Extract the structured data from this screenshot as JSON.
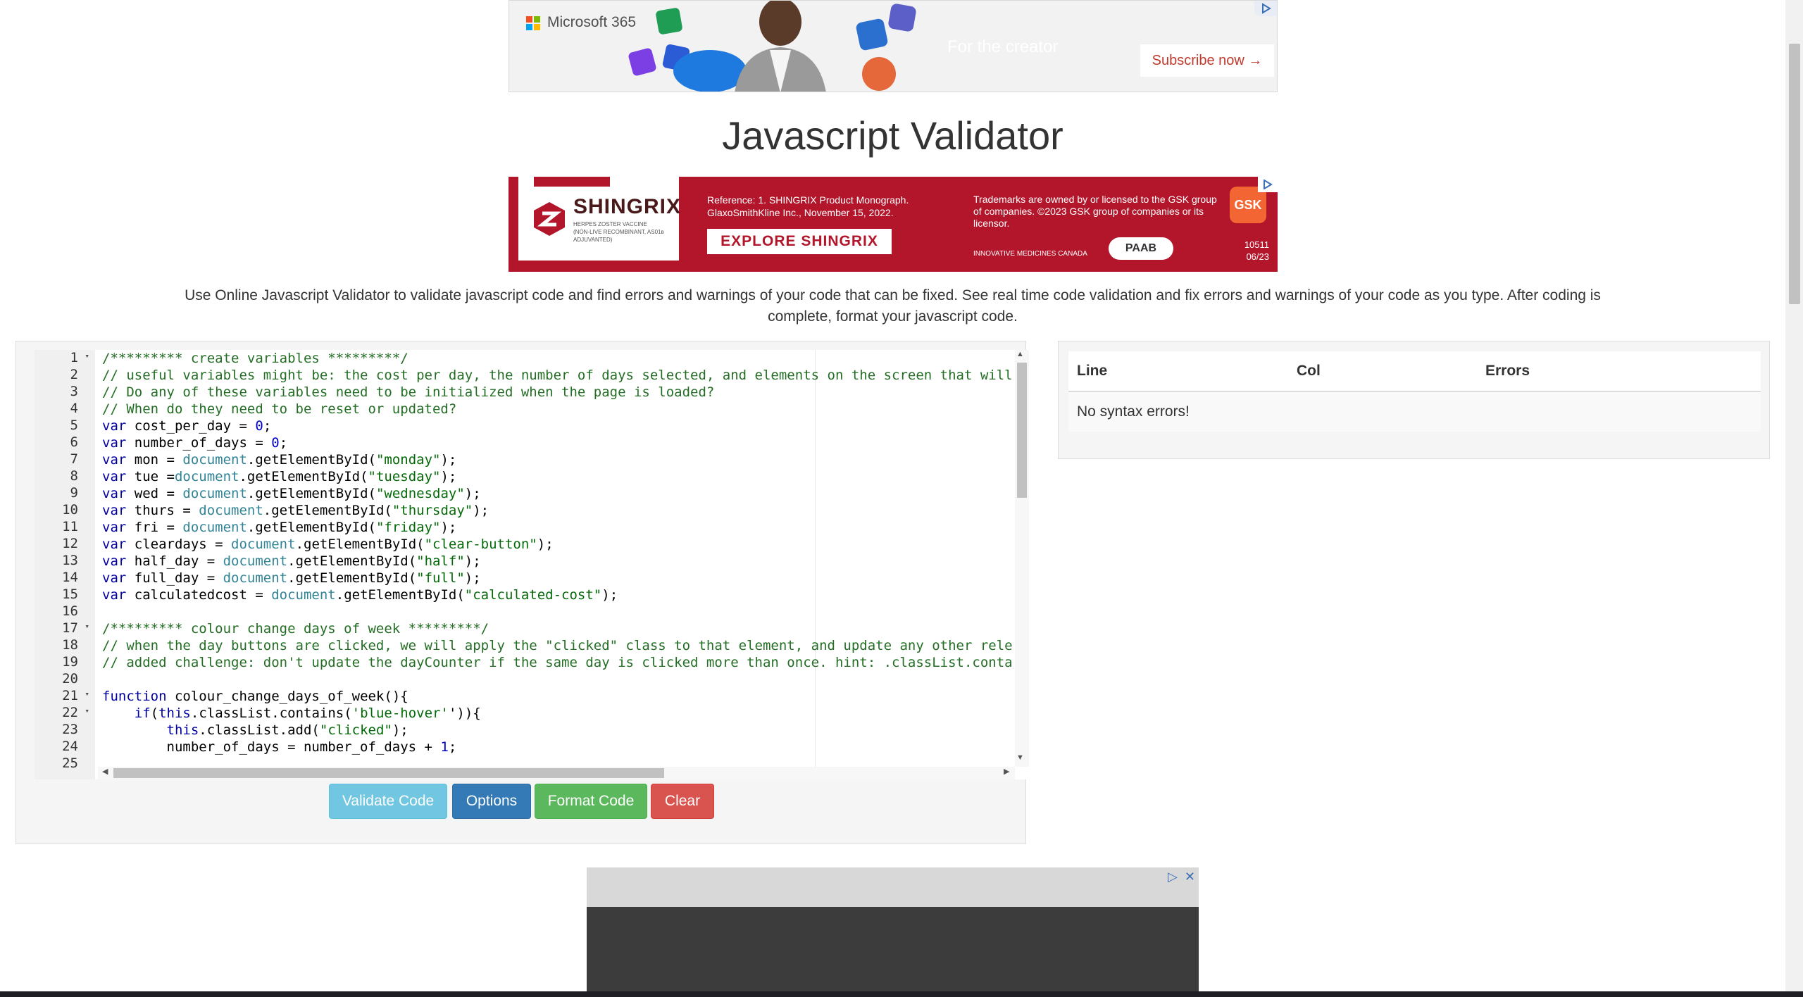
{
  "page": {
    "title": "Javascript Validator",
    "description": "Use Online Javascript Validator to validate javascript code and find errors and warnings of your code that can be fixed. See real time code validation and fix errors and warnings of your code as you type. After coding is complete, format your javascript code."
  },
  "ads": {
    "top": {
      "brand": "Microsoft 365",
      "tagline": "For the creator",
      "cta": "Subscribe now →"
    },
    "middle": {
      "brand": "SHINGRIX",
      "brand_sub": "HERPES ZOSTER VACCINE (NON-LIVE RECOMBINANT, AS01ʙ ADJUVANTED)",
      "reference": "Reference: 1. SHINGRIX Product Monograph. GlaxoSmithKline Inc., November 15, 2022.",
      "cta": "EXPLORE SHINGRIX",
      "trademark": "Trademarks are owned by or licensed to the GSK group of companies. ©2023 GSK group of companies or its licensor.",
      "imc": "INNOVATIVE MEDICINES CANADA",
      "paab": "PAAB",
      "gsk": "GSK",
      "code_line1": "10511",
      "code_line2": "06/23"
    }
  },
  "editor": {
    "lines": [
      {
        "n": "1",
        "fold": true
      },
      {
        "n": "2"
      },
      {
        "n": "3"
      },
      {
        "n": "4"
      },
      {
        "n": "5"
      },
      {
        "n": "6"
      },
      {
        "n": "7"
      },
      {
        "n": "8"
      },
      {
        "n": "9"
      },
      {
        "n": "10"
      },
      {
        "n": "11"
      },
      {
        "n": "12"
      },
      {
        "n": "13"
      },
      {
        "n": "14"
      },
      {
        "n": "15"
      },
      {
        "n": "16"
      },
      {
        "n": "17",
        "fold": true
      },
      {
        "n": "18"
      },
      {
        "n": "19"
      },
      {
        "n": "20"
      },
      {
        "n": "21",
        "fold": true
      },
      {
        "n": "22",
        "fold": true
      },
      {
        "n": "23"
      },
      {
        "n": "24"
      },
      {
        "n": "25"
      }
    ],
    "code": [
      [
        [
          "c",
          "/********* create variables *********/"
        ]
      ],
      [
        [
          "c",
          "// useful variables might be: the cost per day, the number of days selected, and elements on the screen that will"
        ]
      ],
      [
        [
          "c",
          "// Do any of these variables need to be initialized when the page is loaded?"
        ]
      ],
      [
        [
          "c",
          "// When do they need to be reset or updated?"
        ]
      ],
      [
        [
          "k",
          "var"
        ],
        [
          "t",
          " cost_per_day = "
        ],
        [
          "n",
          "0"
        ],
        [
          "t",
          ";"
        ]
      ],
      [
        [
          "k",
          "var"
        ],
        [
          "t",
          " number_of_days = "
        ],
        [
          "n",
          "0"
        ],
        [
          "t",
          ";"
        ]
      ],
      [
        [
          "k",
          "var"
        ],
        [
          "t",
          " mon = "
        ],
        [
          "p",
          "document"
        ],
        [
          "t",
          ".getElementById("
        ],
        [
          "s",
          "\"monday\""
        ],
        [
          "t",
          ");"
        ]
      ],
      [
        [
          "k",
          "var"
        ],
        [
          "t",
          " tue ="
        ],
        [
          "p",
          "document"
        ],
        [
          "t",
          ".getElementById("
        ],
        [
          "s",
          "\"tuesday\""
        ],
        [
          "t",
          ");"
        ]
      ],
      [
        [
          "k",
          "var"
        ],
        [
          "t",
          " wed = "
        ],
        [
          "p",
          "document"
        ],
        [
          "t",
          ".getElementById("
        ],
        [
          "s",
          "\"wednesday\""
        ],
        [
          "t",
          ");"
        ]
      ],
      [
        [
          "k",
          "var"
        ],
        [
          "t",
          " thurs = "
        ],
        [
          "p",
          "document"
        ],
        [
          "t",
          ".getElementById("
        ],
        [
          "s",
          "\"thursday\""
        ],
        [
          "t",
          ");"
        ]
      ],
      [
        [
          "k",
          "var"
        ],
        [
          "t",
          " fri = "
        ],
        [
          "p",
          "document"
        ],
        [
          "t",
          ".getElementById("
        ],
        [
          "s",
          "\"friday\""
        ],
        [
          "t",
          ");"
        ]
      ],
      [
        [
          "k",
          "var"
        ],
        [
          "t",
          " cleardays = "
        ],
        [
          "p",
          "document"
        ],
        [
          "t",
          ".getElementById("
        ],
        [
          "s",
          "\"clear-button\""
        ],
        [
          "t",
          ");"
        ]
      ],
      [
        [
          "k",
          "var"
        ],
        [
          "t",
          " half_day = "
        ],
        [
          "p",
          "document"
        ],
        [
          "t",
          ".getElementById("
        ],
        [
          "s",
          "\"half\""
        ],
        [
          "t",
          ");"
        ]
      ],
      [
        [
          "k",
          "var"
        ],
        [
          "t",
          " full_day = "
        ],
        [
          "p",
          "document"
        ],
        [
          "t",
          ".getElementById("
        ],
        [
          "s",
          "\"full\""
        ],
        [
          "t",
          ");"
        ]
      ],
      [
        [
          "k",
          "var"
        ],
        [
          "t",
          " calculatedcost = "
        ],
        [
          "p",
          "document"
        ],
        [
          "t",
          ".getElementById("
        ],
        [
          "s",
          "\"calculated-cost\""
        ],
        [
          "t",
          ");"
        ]
      ],
      [],
      [
        [
          "c",
          "/********* colour change days of week *********/"
        ]
      ],
      [
        [
          "c",
          "// when the day buttons are clicked, we will apply the \"clicked\" class to that element, and update any other rele"
        ]
      ],
      [
        [
          "c",
          "// added challenge: don't update the dayCounter if the same day is clicked more than once. hint: .classList.conta"
        ]
      ],
      [],
      [
        [
          "k",
          "function"
        ],
        [
          "t",
          " "
        ],
        [
          "f",
          "colour_change_days_of_week"
        ],
        [
          "t",
          "(){"
        ]
      ],
      [
        [
          "t",
          "    "
        ],
        [
          "k",
          "if"
        ],
        [
          "t",
          "("
        ],
        [
          "k",
          "this"
        ],
        [
          "t",
          ".classList.contains("
        ],
        [
          "s",
          "'blue-hover'"
        ],
        [
          "t",
          "')){"
        ]
      ],
      [
        [
          "t",
          "        "
        ],
        [
          "k",
          "this"
        ],
        [
          "t",
          ".classList.add("
        ],
        [
          "s",
          "\"clicked\""
        ],
        [
          "t",
          ");"
        ]
      ],
      [
        [
          "t",
          "        number_of_days = number_of_days + "
        ],
        [
          "n",
          "1"
        ],
        [
          "t",
          ";"
        ]
      ],
      []
    ]
  },
  "buttons": {
    "validate": "Validate Code",
    "options": "Options",
    "format": "Format Code",
    "clear": "Clear"
  },
  "errors": {
    "headers": {
      "line": "Line",
      "col": "Col",
      "errors": "Errors"
    },
    "message": "No syntax errors!"
  },
  "colors": {
    "validate": "#5bc0de",
    "options": "#337ab7",
    "format": "#5cb85c",
    "clear": "#d9534f",
    "shingrix_red": "#b3162b"
  }
}
